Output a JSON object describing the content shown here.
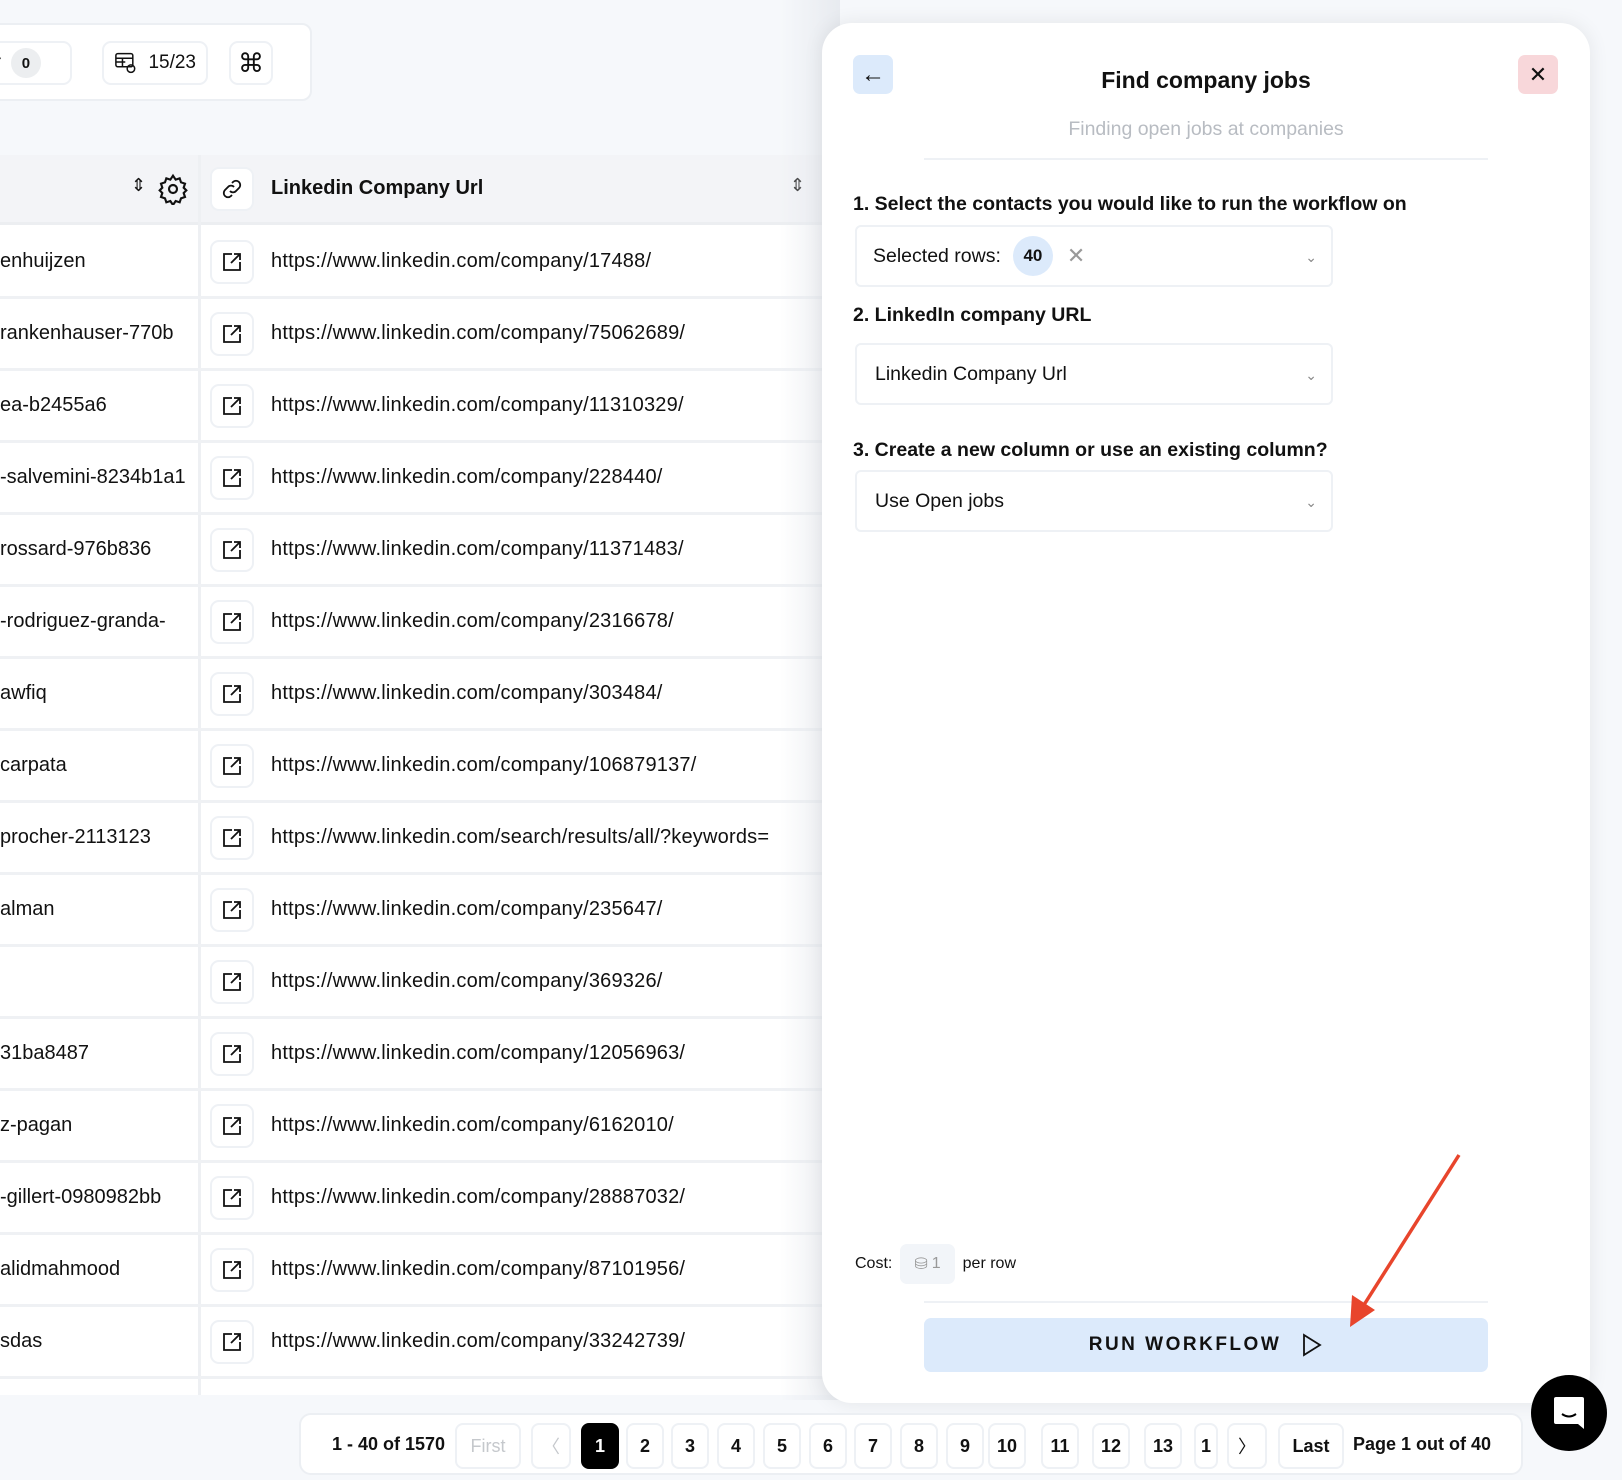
{
  "toolbar": {
    "filter_label_partial": "er",
    "filter_count": "0",
    "columns_count": "15/23"
  },
  "table": {
    "header": {
      "col2_title": "Linkedin Company Url"
    },
    "rows": [
      {
        "name": "enhuijzen",
        "url": "https://www.linkedin.com/company/17488/"
      },
      {
        "name": "rankenhauser-770b",
        "url": "https://www.linkedin.com/company/75062689/"
      },
      {
        "name": "ea-b2455a6",
        "url": "https://www.linkedin.com/company/11310329/"
      },
      {
        "name": "-salvemini-8234b1a1",
        "url": "https://www.linkedin.com/company/228440/"
      },
      {
        "name": "rossard-976b836",
        "url": "https://www.linkedin.com/company/11371483/"
      },
      {
        "name": "-rodriguez-granda-",
        "url": "https://www.linkedin.com/company/2316678/"
      },
      {
        "name": "awfiq",
        "url": "https://www.linkedin.com/company/303484/"
      },
      {
        "name": "carpata",
        "url": "https://www.linkedin.com/company/106879137/"
      },
      {
        "name": "procher-2113123",
        "url": "https://www.linkedin.com/search/results/all/?keywords="
      },
      {
        "name": "alman",
        "url": "https://www.linkedin.com/company/235647/"
      },
      {
        "name": "",
        "url": "https://www.linkedin.com/company/369326/"
      },
      {
        "name": "31ba8487",
        "url": "https://www.linkedin.com/company/12056963/"
      },
      {
        "name": "z-pagan",
        "url": "https://www.linkedin.com/company/6162010/"
      },
      {
        "name": "-gillert-0980982bb",
        "url": "https://www.linkedin.com/company/28887032/"
      },
      {
        "name": "alidmahmood",
        "url": "https://www.linkedin.com/company/87101956/"
      },
      {
        "name": "sdas",
        "url": "https://www.linkedin.com/company/33242739/"
      }
    ]
  },
  "panel": {
    "title": "Find company jobs",
    "subtitle": "Finding open jobs at companies",
    "step1_label": "1. Select the contacts you would like to run the workflow on",
    "selected_rows_label": "Selected rows:",
    "selected_rows_count": "40",
    "step2_label": "2.  LinkedIn company URL",
    "step2_value": "Linkedin Company Url",
    "step3_label": "3. Create a new column or use an existing column?",
    "step3_value": "Use Open jobs",
    "cost_label": "Cost:",
    "cost_value": "1",
    "cost_unit": "per row",
    "run_label": "RUN WORKFLOW"
  },
  "pagination": {
    "range": "1 - 40 of 1570",
    "first": "First",
    "pages": [
      "1",
      "2",
      "3",
      "4",
      "5",
      "6",
      "7",
      "8",
      "9",
      "10",
      "11",
      "12",
      "13",
      "1"
    ],
    "current": "1",
    "last": "Last",
    "page_info": "Page 1 out of 40"
  },
  "colors": {
    "accent_light": "#dceafb",
    "close_bg": "#f8d7da",
    "arrow": "#e8452c"
  }
}
